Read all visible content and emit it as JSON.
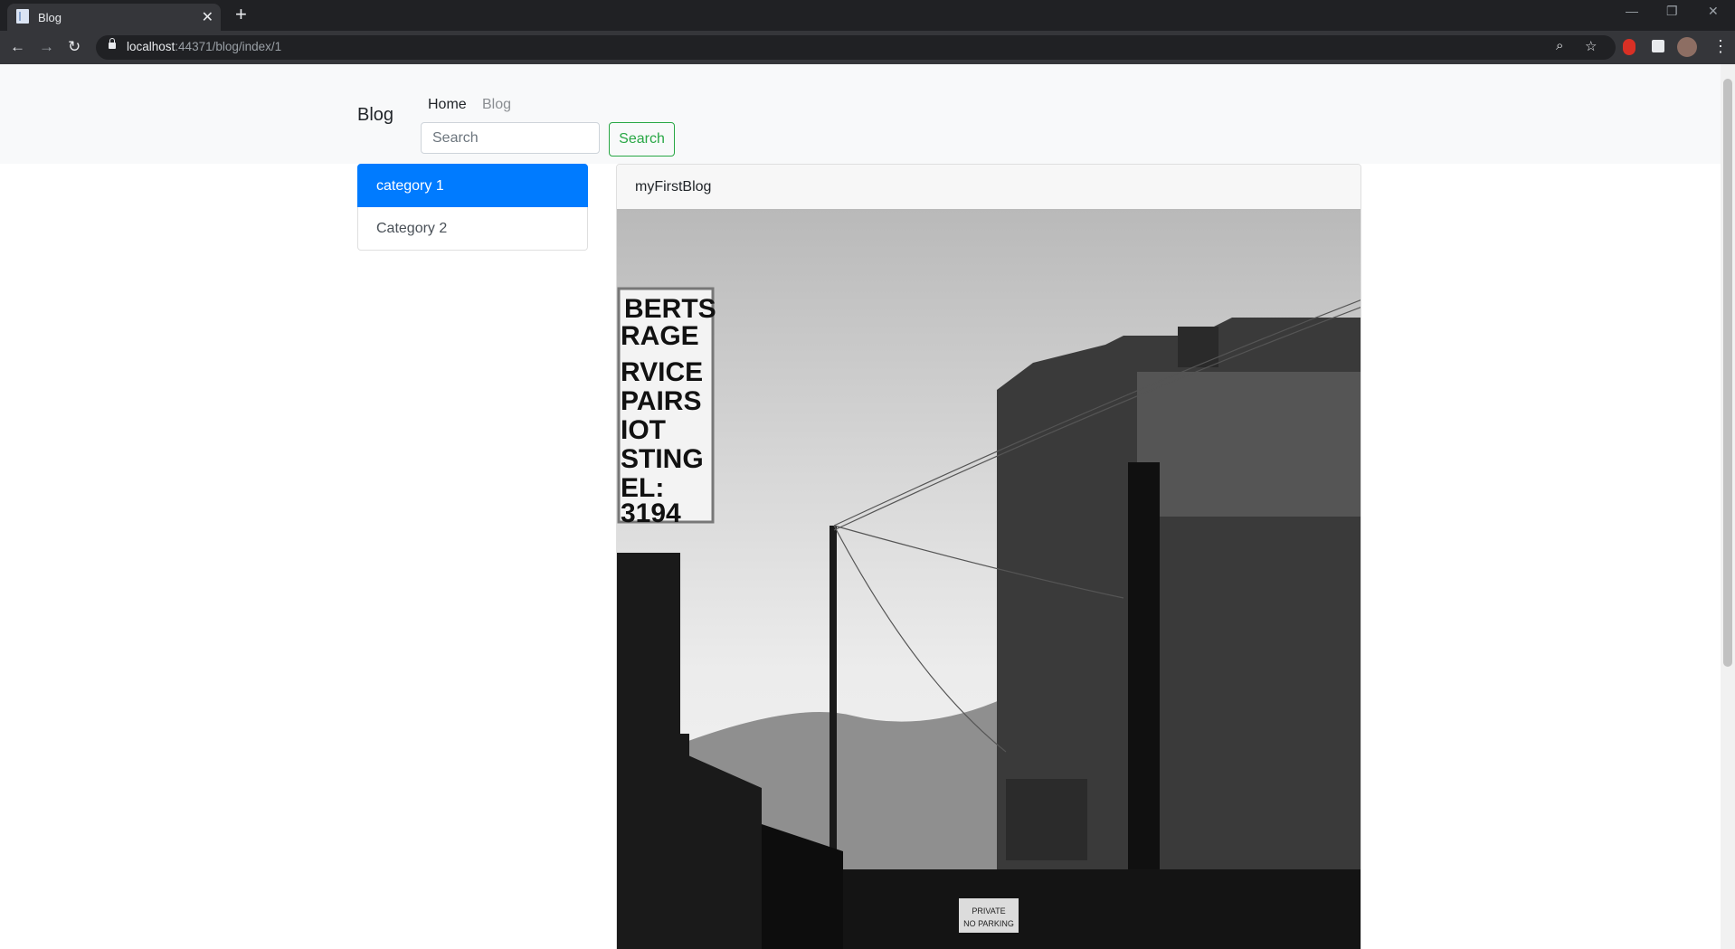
{
  "browser": {
    "tab_title": "Blog",
    "url_host": "localhost",
    "url_rest": ":44371/blog/index/1"
  },
  "navbar": {
    "brand": "Blog",
    "links": [
      "Home",
      "Blog"
    ],
    "search_placeholder": "Search",
    "search_button": "Search"
  },
  "categories": [
    "category 1",
    "Category 2"
  ],
  "post": {
    "title": "myFirstBlog",
    "sign_lines": [
      "BERTS",
      "RAGE",
      "RVICE",
      "PAIRS",
      "IOT",
      "STING",
      "EL:",
      "3194"
    ],
    "parking_sign": [
      "PRIVATE",
      "NO PARKING"
    ]
  },
  "colors": {
    "primary": "#007bff",
    "success": "#28a745",
    "navbar_bg": "#f8f9fa"
  }
}
